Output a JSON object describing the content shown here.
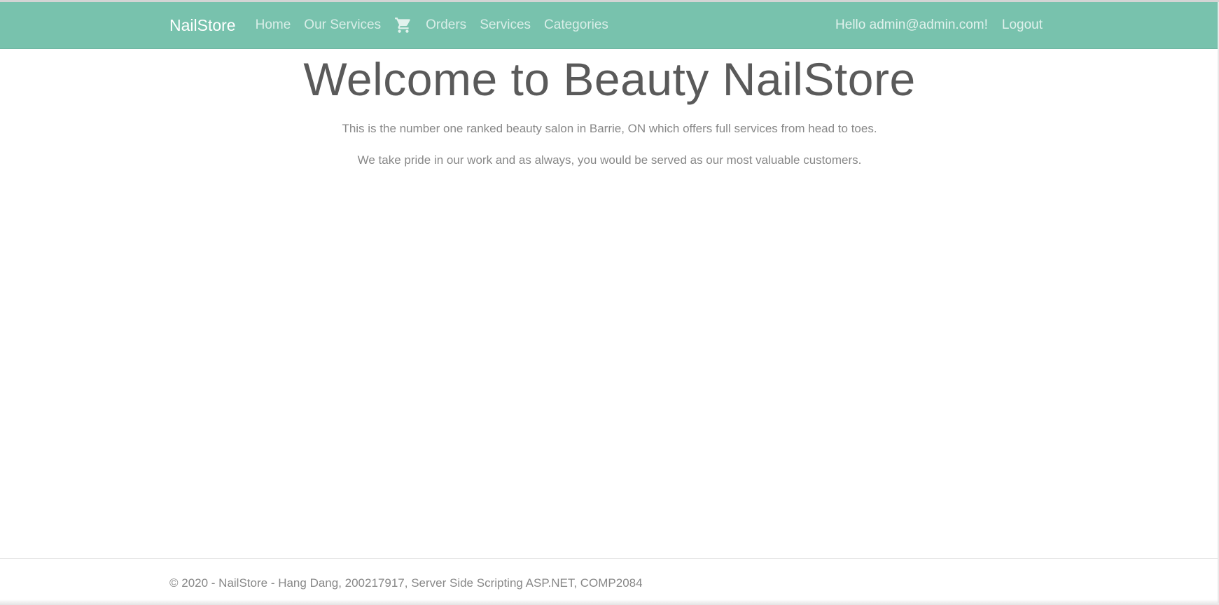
{
  "navbar": {
    "brand": "NailStore",
    "links": [
      {
        "label": "Home"
      },
      {
        "label": "Our Services"
      },
      {
        "icon": "shopping-cart-icon"
      },
      {
        "label": "Orders"
      },
      {
        "label": "Services"
      },
      {
        "label": "Categories"
      }
    ],
    "greeting": "Hello admin@admin.com!",
    "logout_label": "Logout",
    "background_color": "#78c2ad"
  },
  "main": {
    "heading": "Welcome to Beauty NailStore",
    "paragraph_1": "This is the number one ranked beauty salon in Barrie, ON which offers full services from head to toes.",
    "paragraph_2": "We take pride in our work and as always, you would be served as our most valuable customers."
  },
  "footer": {
    "text": "© 2020 - NailStore - Hang Dang, 200217917, Server Side Scripting ASP.NET, COMP2084"
  }
}
